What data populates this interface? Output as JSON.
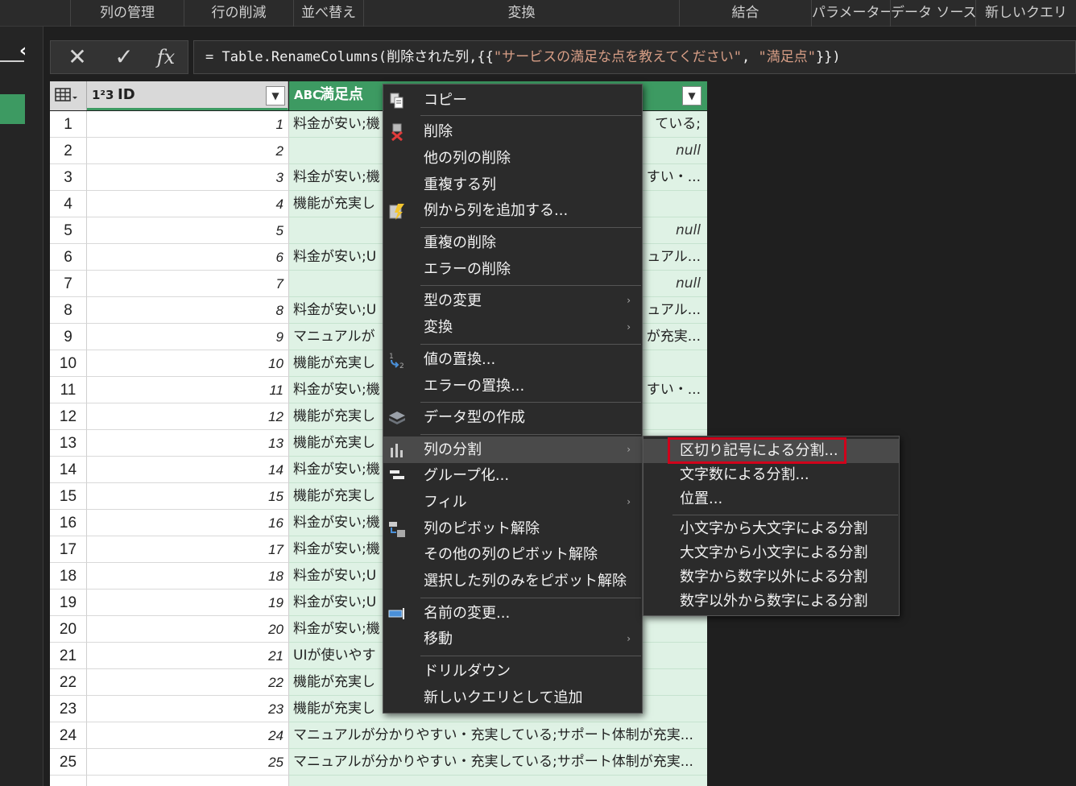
{
  "ribbon": {
    "groups": [
      "列の管理",
      "行の削減",
      "並べ替え",
      "変換",
      "結合",
      "パラメーター",
      "データ ソース",
      "新しいクエリ"
    ]
  },
  "formula_bar": {
    "cancel_icon": "✕",
    "commit_icon": "✓",
    "fx_label": "fx",
    "formula_prefix": "= Table.RenameColumns(削除された列,{{",
    "formula_str1": "\"サービスの満足な点を教えてください\"",
    "formula_sep": ", ",
    "formula_str2": "\"満足点\"",
    "formula_suffix": "}})"
  },
  "grid": {
    "columns": [
      {
        "type_icon": "1²3",
        "name": "ID"
      },
      {
        "type_icon": "ABC",
        "name": "満足点"
      }
    ],
    "rows": [
      {
        "n": "1",
        "id": "1",
        "left": "料金が安い;機",
        "right": "ている;"
      },
      {
        "n": "2",
        "id": "2",
        "left": "",
        "right": "null"
      },
      {
        "n": "3",
        "id": "3",
        "left": "料金が安い;機",
        "right": "すい・..."
      },
      {
        "n": "4",
        "id": "4",
        "left": "機能が充実し",
        "right": ""
      },
      {
        "n": "5",
        "id": "5",
        "left": "",
        "right": "null"
      },
      {
        "n": "6",
        "id": "6",
        "left": "料金が安い;U",
        "right": "ュアル..."
      },
      {
        "n": "7",
        "id": "7",
        "left": "",
        "right": "null"
      },
      {
        "n": "8",
        "id": "8",
        "left": "料金が安い;U",
        "right": "ュアル..."
      },
      {
        "n": "9",
        "id": "9",
        "left": "マニュアルが",
        "right": "が充実..."
      },
      {
        "n": "10",
        "id": "10",
        "left": "機能が充実し",
        "right": ""
      },
      {
        "n": "11",
        "id": "11",
        "left": "料金が安い;機",
        "right": "すい・..."
      },
      {
        "n": "12",
        "id": "12",
        "left": "機能が充実し",
        "right": ""
      },
      {
        "n": "13",
        "id": "13",
        "left": "機能が充実し",
        "right": ""
      },
      {
        "n": "14",
        "id": "14",
        "left": "料金が安い;機",
        "right": ""
      },
      {
        "n": "15",
        "id": "15",
        "left": "機能が充実し",
        "right": ""
      },
      {
        "n": "16",
        "id": "16",
        "left": "料金が安い;機",
        "right": ""
      },
      {
        "n": "17",
        "id": "17",
        "left": "料金が安い;機",
        "right": ""
      },
      {
        "n": "18",
        "id": "18",
        "left": "料金が安い;U",
        "right": ""
      },
      {
        "n": "19",
        "id": "19",
        "left": "料金が安い;U",
        "right": ""
      },
      {
        "n": "20",
        "id": "20",
        "left": "料金が安い;機",
        "right": ""
      },
      {
        "n": "21",
        "id": "21",
        "left": "UIが使いやす",
        "right": ""
      },
      {
        "n": "22",
        "id": "22",
        "left": "機能が充実し",
        "right": ""
      },
      {
        "n": "23",
        "id": "23",
        "left": "機能が充実し",
        "right": ""
      },
      {
        "n": "24",
        "id": "24",
        "left": "マニュアルが分かりやすい・充実している;サポート体制が充実...",
        "right": ""
      },
      {
        "n": "25",
        "id": "25",
        "left": "マニュアルが分かりやすい・充実している;サポート体制が充実...",
        "right": ""
      }
    ]
  },
  "context_menu": {
    "items": [
      {
        "label": "コピー",
        "icon": "copy-icon"
      },
      {
        "label": "削除",
        "icon": "delete-column-icon"
      },
      {
        "label": "他の列の削除",
        "icon": ""
      },
      {
        "label": "重複する列",
        "icon": ""
      },
      {
        "label": "例から列を追加する...",
        "icon": "column-from-examples-icon"
      },
      {
        "label": "重複の削除",
        "icon": ""
      },
      {
        "label": "エラーの削除",
        "icon": ""
      },
      {
        "label": "型の変更",
        "icon": "",
        "submenu": true
      },
      {
        "label": "変換",
        "icon": "",
        "submenu": true
      },
      {
        "label": "値の置換...",
        "icon": "replace-values-icon"
      },
      {
        "label": "エラーの置換...",
        "icon": ""
      },
      {
        "label": "データ型の作成",
        "icon": "data-type-icon"
      },
      {
        "label": "列の分割",
        "icon": "split-column-icon",
        "submenu": true,
        "highlighted": true
      },
      {
        "label": "グループ化...",
        "icon": "group-by-icon"
      },
      {
        "label": "フィル",
        "icon": "",
        "submenu": true
      },
      {
        "label": "列のピボット解除",
        "icon": "unpivot-icon"
      },
      {
        "label": "その他の列のピボット解除",
        "icon": ""
      },
      {
        "label": "選択した列のみをピボット解除",
        "icon": ""
      },
      {
        "label": "名前の変更...",
        "icon": "rename-icon"
      },
      {
        "label": "移動",
        "icon": "",
        "submenu": true
      },
      {
        "label": "ドリルダウン",
        "icon": ""
      },
      {
        "label": "新しいクエリとして追加",
        "icon": ""
      }
    ]
  },
  "submenu": {
    "items": [
      {
        "label": "区切り記号による分割...",
        "highlighted": true
      },
      {
        "label": "文字数による分割..."
      },
      {
        "label": "位置..."
      },
      {
        "label": "小文字から大文字による分割"
      },
      {
        "label": "大文字から小文字による分割"
      },
      {
        "label": "数字から数字以外による分割"
      },
      {
        "label": "数字以外から数字による分割"
      }
    ]
  },
  "colors": {
    "accent": "#3d9a62",
    "highlight_box": "#d0021b"
  }
}
